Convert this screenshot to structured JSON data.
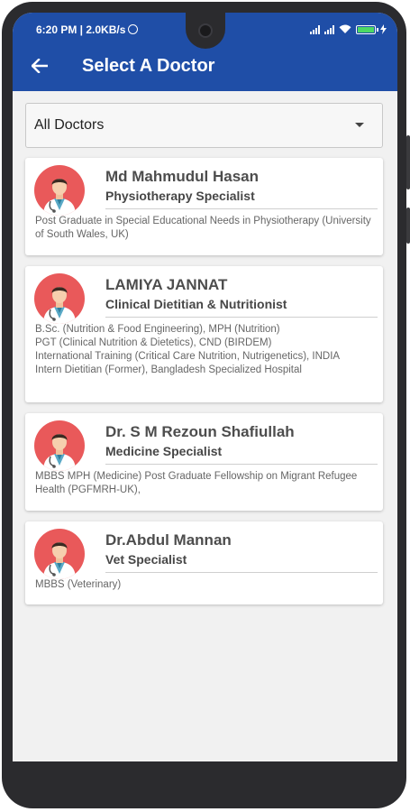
{
  "status_bar": {
    "time_info": "6:20 PM | 2.0KB/s"
  },
  "app_bar": {
    "title": "Select A Doctor",
    "back_icon": "arrow-left-icon",
    "background": "#1f4ea7"
  },
  "filter": {
    "selected": "All Doctors",
    "icon": "dropdown-arrow-icon"
  },
  "doctors": [
    {
      "name": "Md Mahmudul Hasan",
      "specialty": "Physiotherapy Specialist",
      "qualifications": "Post Graduate in Special Educational Needs in Physiotherapy (University of South Wales, UK)"
    },
    {
      "name": "LAMIYA JANNAT",
      "specialty": "Clinical Dietitian & Nutritionist",
      "qualifications": "B.Sc. (Nutrition & Food Engineering), MPH (Nutrition)\nPGT (Clinical Nutrition & Dietetics), CND (BIRDEM)\nInternational Training (Critical Care Nutrition, Nutrigenetics), INDIA\nIntern Dietitian (Former), Bangladesh Specialized Hospital"
    },
    {
      "name": "Dr. S M Rezoun Shafiullah",
      "specialty": "Medicine Specialist",
      "qualifications": "MBBS MPH (Medicine) Post Graduate Fellowship on Migrant Refugee Health (PGFMRH-UK),"
    },
    {
      "name": "Dr.Abdul Mannan",
      "specialty": "Vet Specialist",
      "qualifications": "MBBS (Veterinary)"
    }
  ],
  "colors": {
    "avatar_bg": "#e9595a",
    "appbar": "#1f4ea7"
  }
}
